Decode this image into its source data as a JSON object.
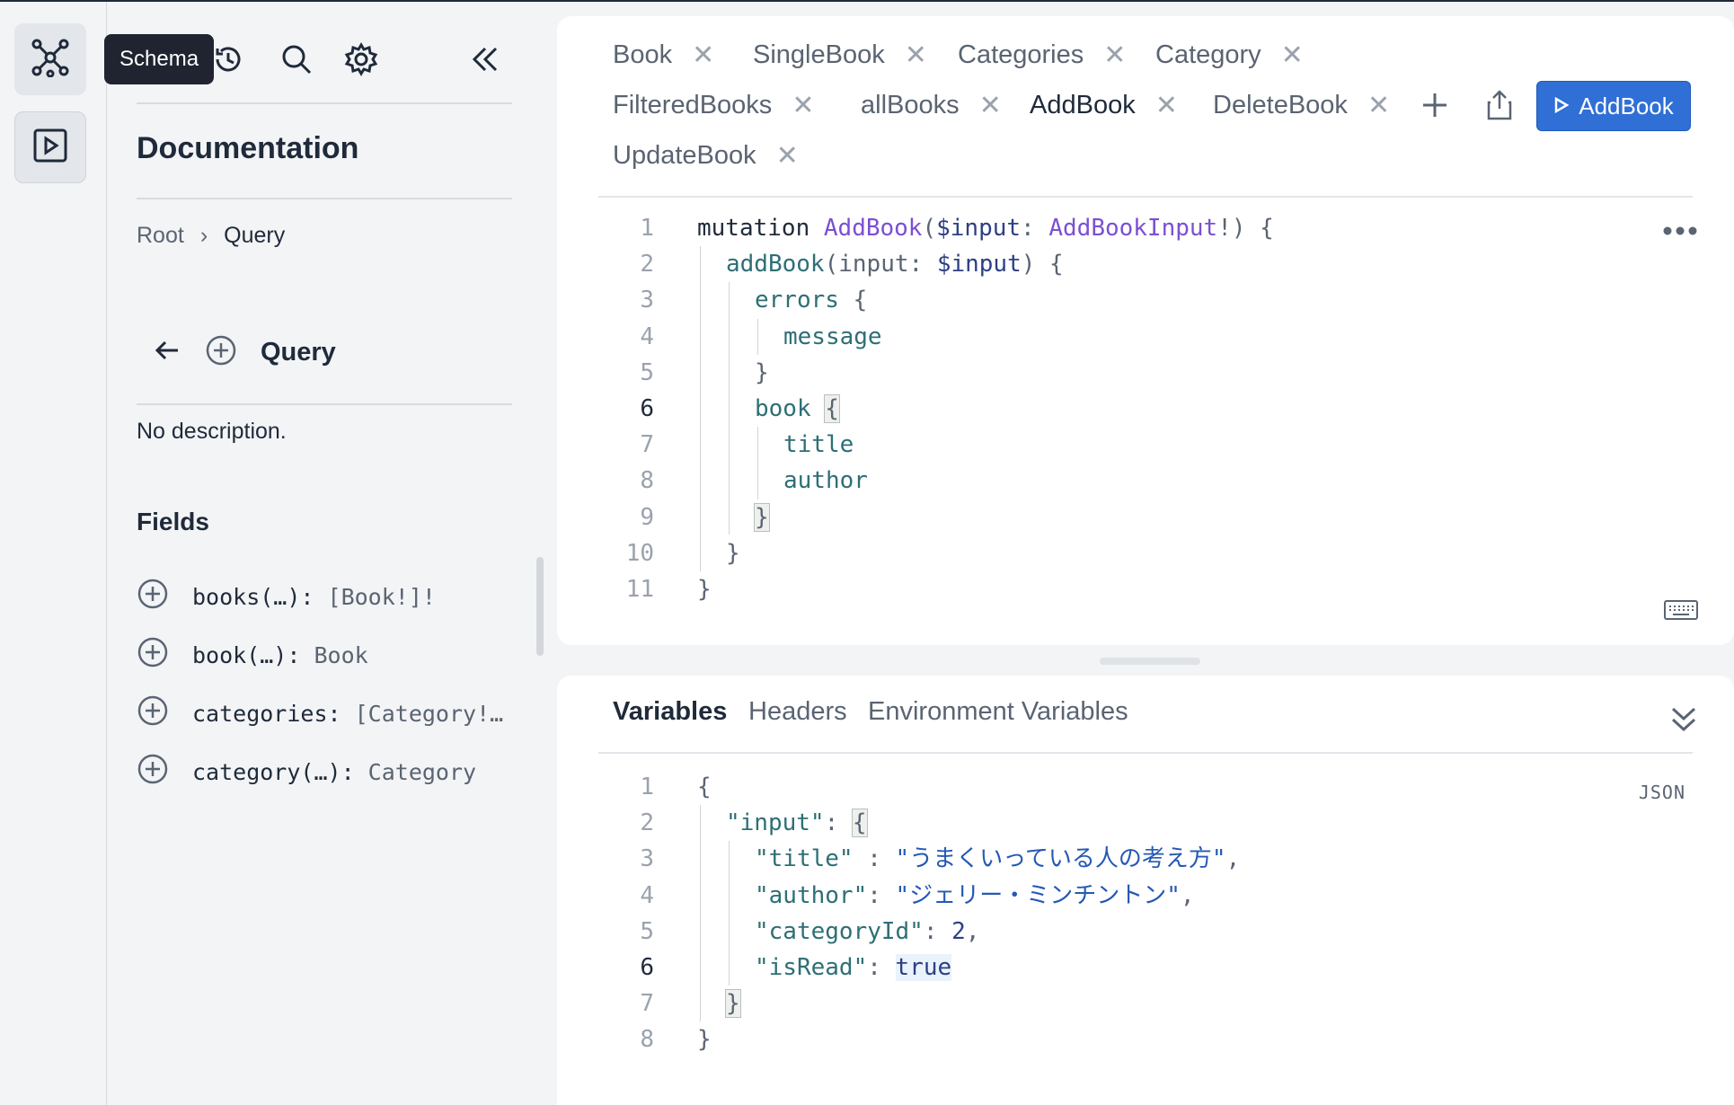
{
  "tooltip": "Schema",
  "rail": {
    "icons": [
      "schema-graph-icon",
      "play-icon"
    ]
  },
  "docs": {
    "title": "Documentation",
    "breadcrumb": {
      "root": "Root",
      "separator": "›",
      "current": "Query"
    },
    "query_label": "Query",
    "description": "No description.",
    "fields_heading": "Fields",
    "fields": [
      {
        "name": "books(…): ",
        "type": "[Book!]!"
      },
      {
        "name": "book(…): ",
        "type": "Book"
      },
      {
        "name": "categories: ",
        "type": "[Category!…"
      },
      {
        "name": "category(…): ",
        "type": "Category"
      }
    ]
  },
  "tabs": [
    {
      "label": "Book"
    },
    {
      "label": "SingleBook"
    },
    {
      "label": "Categories"
    },
    {
      "label": "Category"
    },
    {
      "label": "FilteredBooks"
    },
    {
      "label": "allBooks"
    },
    {
      "label": "AddBook",
      "active": true
    },
    {
      "label": "DeleteBook"
    },
    {
      "label": "UpdateBook"
    }
  ],
  "tab_close": "✕",
  "run_button": "AddBook",
  "query": {
    "line_numbers": [
      "1",
      "2",
      "3",
      "4",
      "5",
      "6",
      "7",
      "8",
      "9",
      "10",
      "11"
    ],
    "current_line": "6",
    "l1": {
      "kw": "mutation ",
      "name": "AddBook",
      "open": "(",
      "var": "$input",
      "colon": ": ",
      "type": "AddBookInput",
      "close": "!) {"
    },
    "l2": {
      "field": "addBook",
      "open": "(input: ",
      "var": "$input",
      "close": ") {"
    },
    "l3": {
      "field": "errors",
      "brace": " {"
    },
    "l4": {
      "field": "message"
    },
    "l5": "}",
    "l6": {
      "field": "book",
      "brace": "{"
    },
    "l7": {
      "field": "title"
    },
    "l8": {
      "field": "author"
    },
    "l9": "}",
    "l10": "}",
    "l11": "}"
  },
  "variables_panel": {
    "tabs": [
      "Variables",
      "Headers",
      "Environment Variables"
    ],
    "json_badge": "JSON",
    "line_numbers": [
      "1",
      "2",
      "3",
      "4",
      "5",
      "6",
      "7",
      "8"
    ],
    "current_line": "6",
    "l1": "{",
    "l2": {
      "key": "\"input\"",
      "colon": ": ",
      "brace": "{"
    },
    "l3": {
      "key": "\"title\"",
      "colon": " : ",
      "value": "\"うまくいっている人の考え方\"",
      "comma": ","
    },
    "l4": {
      "key": "\"author\"",
      "colon": ": ",
      "value": "\"ジェリー・ミンチントン\"",
      "comma": ","
    },
    "l5": {
      "key": "\"categoryId\"",
      "colon": ": ",
      "value": "2",
      "comma": ","
    },
    "l6": {
      "key": "\"isRead\"",
      "colon": ": ",
      "value": "true"
    },
    "l7": "}",
    "l8": "}"
  }
}
